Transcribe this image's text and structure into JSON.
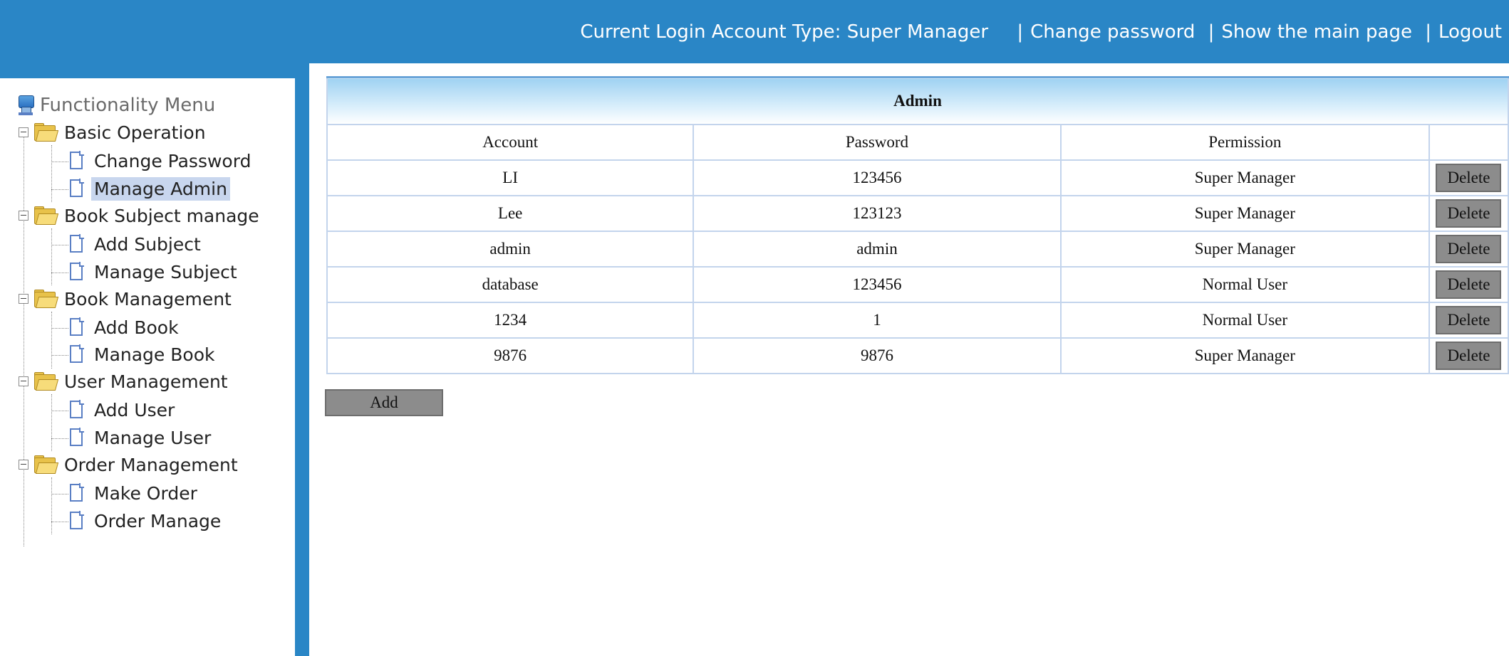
{
  "header": {
    "account_type_text": "Current Login Account Type: Super Manager",
    "links": [
      "Change password",
      "Show the main page",
      "Logout"
    ],
    "separator": "|"
  },
  "sidebar": {
    "root_label": "Functionality Menu",
    "groups": [
      {
        "label": "Basic Operation",
        "items": [
          "Change Password",
          "Manage Admin"
        ]
      },
      {
        "label": "Book Subject manage",
        "items": [
          "Add Subject",
          "Manage Subject"
        ]
      },
      {
        "label": "Book Management",
        "items": [
          "Add Book",
          "Manage Book"
        ]
      },
      {
        "label": "User Management",
        "items": [
          "Add User",
          "Manage User"
        ]
      },
      {
        "label": "Order Management",
        "items": [
          "Make Order",
          "Order Manage"
        ]
      }
    ],
    "selected_item": "Manage Admin"
  },
  "main": {
    "table_title": "Admin",
    "columns": [
      "Account",
      "Password",
      "Permission",
      ""
    ],
    "rows": [
      {
        "account": "LI",
        "password": "123456",
        "permission": "Super Manager"
      },
      {
        "account": "Lee",
        "password": "123123",
        "permission": "Super Manager"
      },
      {
        "account": "admin",
        "password": "admin",
        "permission": "Super Manager"
      },
      {
        "account": "database",
        "password": "123456",
        "permission": "Normal User"
      },
      {
        "account": "1234",
        "password": "1",
        "permission": "Normal User"
      },
      {
        "account": "9876",
        "password": "9876",
        "permission": "Super Manager"
      }
    ],
    "delete_label": "Delete",
    "add_label": "Add"
  },
  "colors": {
    "header_bg": "#2a86c6",
    "selection_bg": "#c8d6ee",
    "table_border": "#c3d4ec",
    "button_bg": "#8c8c8c"
  }
}
